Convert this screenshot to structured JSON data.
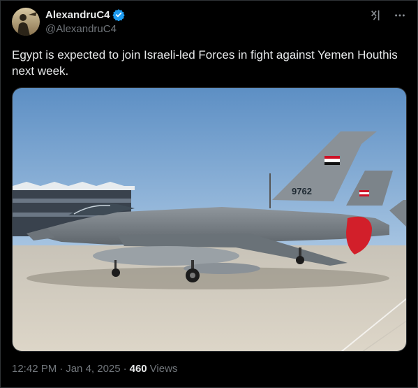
{
  "author": {
    "display_name": "AlexandruC4",
    "handle": "@AlexandruC4",
    "verified_color": "#1d9bf0"
  },
  "icons": {
    "grok": "grok-icon",
    "more": "more-icon",
    "verified": "verified-badge-icon"
  },
  "post": {
    "text": "Egypt is expected to join Israeli-led Forces in fight against Yemen Houthis next week.",
    "media_alt": "F-16 fighter jet with Egyptian flag and tail number 9762 parked on tarmac",
    "tail_number": "9762"
  },
  "meta": {
    "time": "12:42 PM",
    "separator1": "·",
    "date": "Jan 4, 2025",
    "separator2": "·",
    "views_count": "460",
    "views_label": "Views"
  }
}
